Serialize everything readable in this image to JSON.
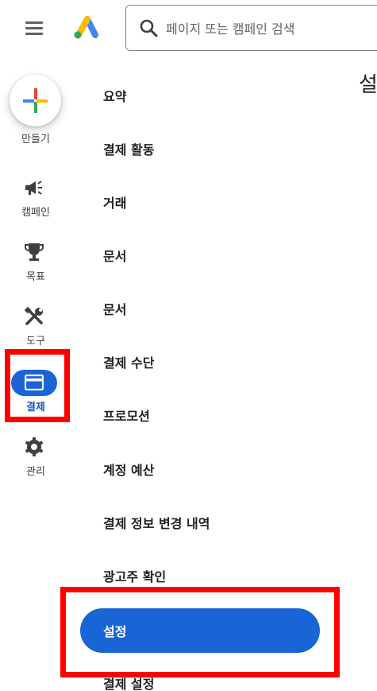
{
  "header": {
    "search_placeholder": "페이지 또는 캠페인 검색"
  },
  "rail": {
    "create_label": "만들기",
    "items": [
      {
        "label": "캠페인",
        "icon": "megaphone-icon"
      },
      {
        "label": "목표",
        "icon": "trophy-icon"
      },
      {
        "label": "도구",
        "icon": "tools-icon"
      },
      {
        "label": "결제",
        "icon": "credit-card-icon",
        "active": true
      },
      {
        "label": "관리",
        "icon": "gear-icon"
      }
    ]
  },
  "subnav": {
    "items": [
      {
        "label": "요약"
      },
      {
        "label": "결제 활동"
      },
      {
        "label": "거래"
      },
      {
        "label": "문서"
      },
      {
        "label": "문서"
      },
      {
        "label": "결제 수단"
      },
      {
        "label": "프로모션"
      },
      {
        "label": "계정 예산"
      },
      {
        "label": "결제 정보 변경 내역"
      },
      {
        "label": "광고주 확인"
      },
      {
        "label": "설정",
        "active": true
      },
      {
        "label": "결제 설정"
      }
    ]
  },
  "main": {
    "title_partial": "설"
  },
  "colors": {
    "accent": "#1a65d6",
    "highlight": "#ff0000",
    "icon_gray": "#3c4043"
  }
}
